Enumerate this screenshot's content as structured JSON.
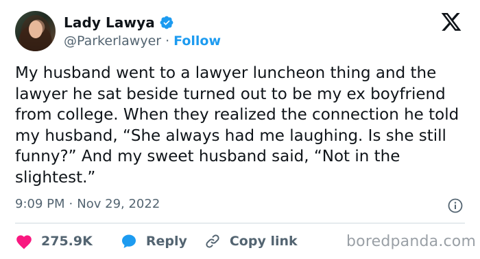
{
  "author": {
    "display_name": "Lady Lawya",
    "handle": "@Parkerlawyer",
    "separator": "·",
    "follow_label": "Follow"
  },
  "tweet": {
    "text": "My husband went to a lawyer luncheon thing and the lawyer he sat beside turned out to be my ex boyfriend from college. When they realized the connection he told my husband, “She always had me laughing. Is she still funny?” And my sweet husband said, “Not in the slightest.”",
    "time": "9:09 PM",
    "separator": "·",
    "date": "Nov 29, 2022"
  },
  "actions": {
    "likes_count": "275.9K",
    "reply_label": "Reply",
    "copy_link_label": "Copy link"
  },
  "watermark": "boredpanda.com",
  "icons": {
    "verified": "verified-badge-icon",
    "logo": "x-logo-icon",
    "info": "info-icon",
    "like": "heart-icon",
    "reply": "speech-bubble-icon",
    "copy": "link-icon"
  },
  "colors": {
    "accent": "#1d9bf0",
    "like": "#f91880",
    "text": "#0f1419",
    "muted": "#536471",
    "watermark": "#9aa0a6"
  }
}
